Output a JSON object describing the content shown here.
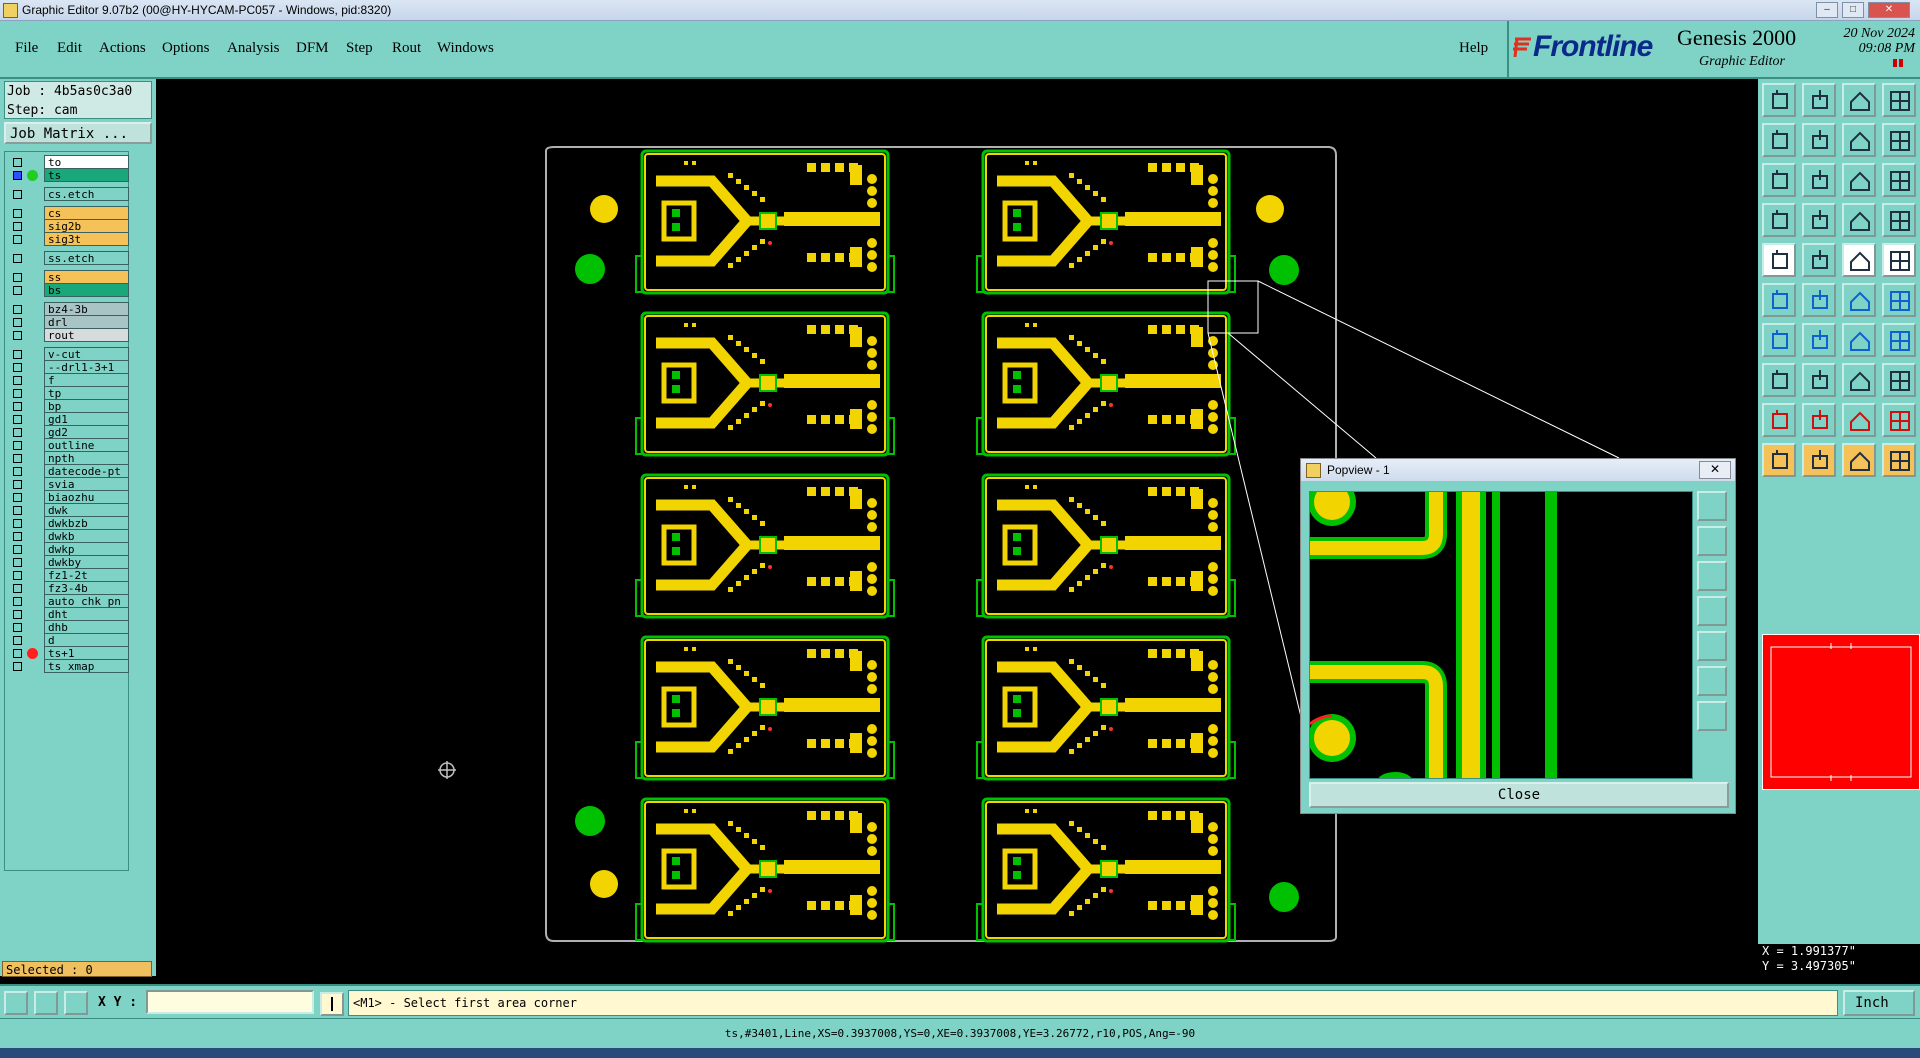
{
  "window": {
    "title": "Graphic Editor 9.07b2 (00@HY-HYCAM-PC057 - Windows, pid:8320)"
  },
  "menu": [
    "File",
    "Edit",
    "Actions",
    "Options",
    "Analysis",
    "DFM",
    "Step",
    "Rout",
    "Windows"
  ],
  "help_label": "Help",
  "brand": {
    "logo_text": "Frontline",
    "product": "Genesis 2000",
    "subtitle": "Graphic Editor",
    "date": "20 Nov 2024",
    "time": "09:08 PM"
  },
  "job": {
    "job_line": "Job : 4b5as0c3a0",
    "step_line": "Step: cam",
    "job_matrix_label": "Job Matrix ..."
  },
  "layers": [
    {
      "name": "to",
      "bg": "#ffffff",
      "dot": "",
      "selected": false
    },
    {
      "name": "ts",
      "bg": "#1aa87a",
      "dot": "#22cc22",
      "selected": true
    },
    {
      "name": "cs.etch",
      "bg": "#7fd3c6",
      "dot": "",
      "selected": false
    },
    {
      "name": "cs",
      "bg": "#f5c25a",
      "dot": "",
      "selected": false
    },
    {
      "name": "sig2b",
      "bg": "#f5c25a",
      "dot": "",
      "selected": false
    },
    {
      "name": "sig3t",
      "bg": "#f5c25a",
      "dot": "",
      "selected": false
    },
    {
      "name": "ss.etch",
      "bg": "#7fd3c6",
      "dot": "",
      "selected": false
    },
    {
      "name": "ss",
      "bg": "#f5c25a",
      "dot": "",
      "selected": false
    },
    {
      "name": "bs",
      "bg": "#1aa87a",
      "dot": "",
      "selected": false
    },
    {
      "name": "bz4-3b",
      "bg": "#a8c4c4",
      "dot": "",
      "selected": false
    },
    {
      "name": "drl",
      "bg": "#a8c4c4",
      "dot": "",
      "selected": false
    },
    {
      "name": "rout",
      "bg": "#d6dcdc",
      "dot": "",
      "selected": false
    },
    {
      "name": "v-cut",
      "bg": "#7fd3c6",
      "dot": "",
      "selected": false
    },
    {
      "name": "--drl1-3+1",
      "bg": "#7fd3c6",
      "dot": "",
      "selected": false
    },
    {
      "name": "f",
      "bg": "#7fd3c6",
      "dot": "",
      "selected": false
    },
    {
      "name": "tp",
      "bg": "#7fd3c6",
      "dot": "",
      "selected": false
    },
    {
      "name": "bp",
      "bg": "#7fd3c6",
      "dot": "",
      "selected": false
    },
    {
      "name": "gd1",
      "bg": "#7fd3c6",
      "dot": "",
      "selected": false
    },
    {
      "name": "gd2",
      "bg": "#7fd3c6",
      "dot": "",
      "selected": false
    },
    {
      "name": "outline",
      "bg": "#7fd3c6",
      "dot": "",
      "selected": false
    },
    {
      "name": "npth",
      "bg": "#7fd3c6",
      "dot": "",
      "selected": false
    },
    {
      "name": "datecode-pt",
      "bg": "#7fd3c6",
      "dot": "",
      "selected": false
    },
    {
      "name": "svia",
      "bg": "#7fd3c6",
      "dot": "",
      "selected": false
    },
    {
      "name": "biaozhu",
      "bg": "#7fd3c6",
      "dot": "",
      "selected": false
    },
    {
      "name": "dwk",
      "bg": "#7fd3c6",
      "dot": "",
      "selected": false
    },
    {
      "name": "dwkbzb",
      "bg": "#7fd3c6",
      "dot": "",
      "selected": false
    },
    {
      "name": "dwkb",
      "bg": "#7fd3c6",
      "dot": "",
      "selected": false
    },
    {
      "name": "dwkp",
      "bg": "#7fd3c6",
      "dot": "",
      "selected": false
    },
    {
      "name": "dwkby",
      "bg": "#7fd3c6",
      "dot": "",
      "selected": false
    },
    {
      "name": "fz1-2t",
      "bg": "#7fd3c6",
      "dot": "",
      "selected": false
    },
    {
      "name": "fz3-4b",
      "bg": "#7fd3c6",
      "dot": "",
      "selected": false
    },
    {
      "name": "auto_chk_pn",
      "bg": "#7fd3c6",
      "dot": "",
      "selected": false
    },
    {
      "name": "dht",
      "bg": "#7fd3c6",
      "dot": "",
      "selected": false
    },
    {
      "name": "dhb",
      "bg": "#7fd3c6",
      "dot": "",
      "selected": false
    },
    {
      "name": "d",
      "bg": "#7fd3c6",
      "dot": "",
      "selected": false
    },
    {
      "name": "ts+1",
      "bg": "#7fd3c6",
      "dot": "#ff2020",
      "selected": false
    },
    {
      "name": "ts_xmap",
      "bg": "#7fd3c6",
      "dot": "",
      "selected": false
    }
  ],
  "selected_label": "Selected : 0",
  "coords": {
    "x": "X = 1.991377\"",
    "y": "Y = 3.497305\""
  },
  "bottom": {
    "xy_label": "X Y :",
    "xy_value": "",
    "prompt": "<M1> - Select first area corner",
    "unit": "Inch"
  },
  "status_line": "ts,#3401,Line,XS=0.3937008,YS=0,XE=0.3937008,YE=3.26772,r10,POS,Ang=-90",
  "popview": {
    "title": "Popview - 1",
    "close_label": "Close"
  },
  "colors": {
    "copper": "#f2d400",
    "soldermask": "#00c000",
    "outline": "#b0b0b0",
    "background": "#000000",
    "panel": "#7fd3c6"
  },
  "tool_icons": [
    "snapshot-icon",
    "save-view-icon",
    "home-icon",
    "zoom-window-icon",
    "pan-left-icon",
    "pan-right-icon",
    "zoom-out-icon",
    "zoom-in-icon",
    "fit-all-icon",
    "center-icon",
    "zoom-ratio-icon",
    "query-icon",
    "measure-icon",
    "grid-icon",
    "layers-color-icon",
    "display-options-icon",
    "pad-icon",
    "surface-icon",
    "line-measure-icon",
    "circle-icon",
    "connect-icon",
    "cross-icon",
    "line-add-icon",
    "line-edit-icon",
    "slope-line-icon",
    "line-draw-icon",
    "arc-icon",
    "text-icon",
    "copy-icon",
    "minus-icon",
    "move-icon",
    "resize-icon",
    "triangle-icon",
    "polygon-icon",
    "arch-icon",
    "arch2-icon",
    "select-arrow-icon",
    "select-orange-icon",
    "select-yellow-icon",
    "select-multi-icon"
  ]
}
